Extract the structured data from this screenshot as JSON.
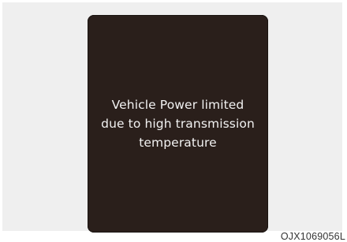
{
  "display": {
    "message_lines": [
      "Vehicle Power limited",
      "due to high transmission",
      "temperature"
    ]
  },
  "figure_code": "OJX1069056L",
  "colors": {
    "frame_background": "#efefef",
    "screen_background": "#2a1f1b",
    "message_text": "#f2f2f2"
  }
}
